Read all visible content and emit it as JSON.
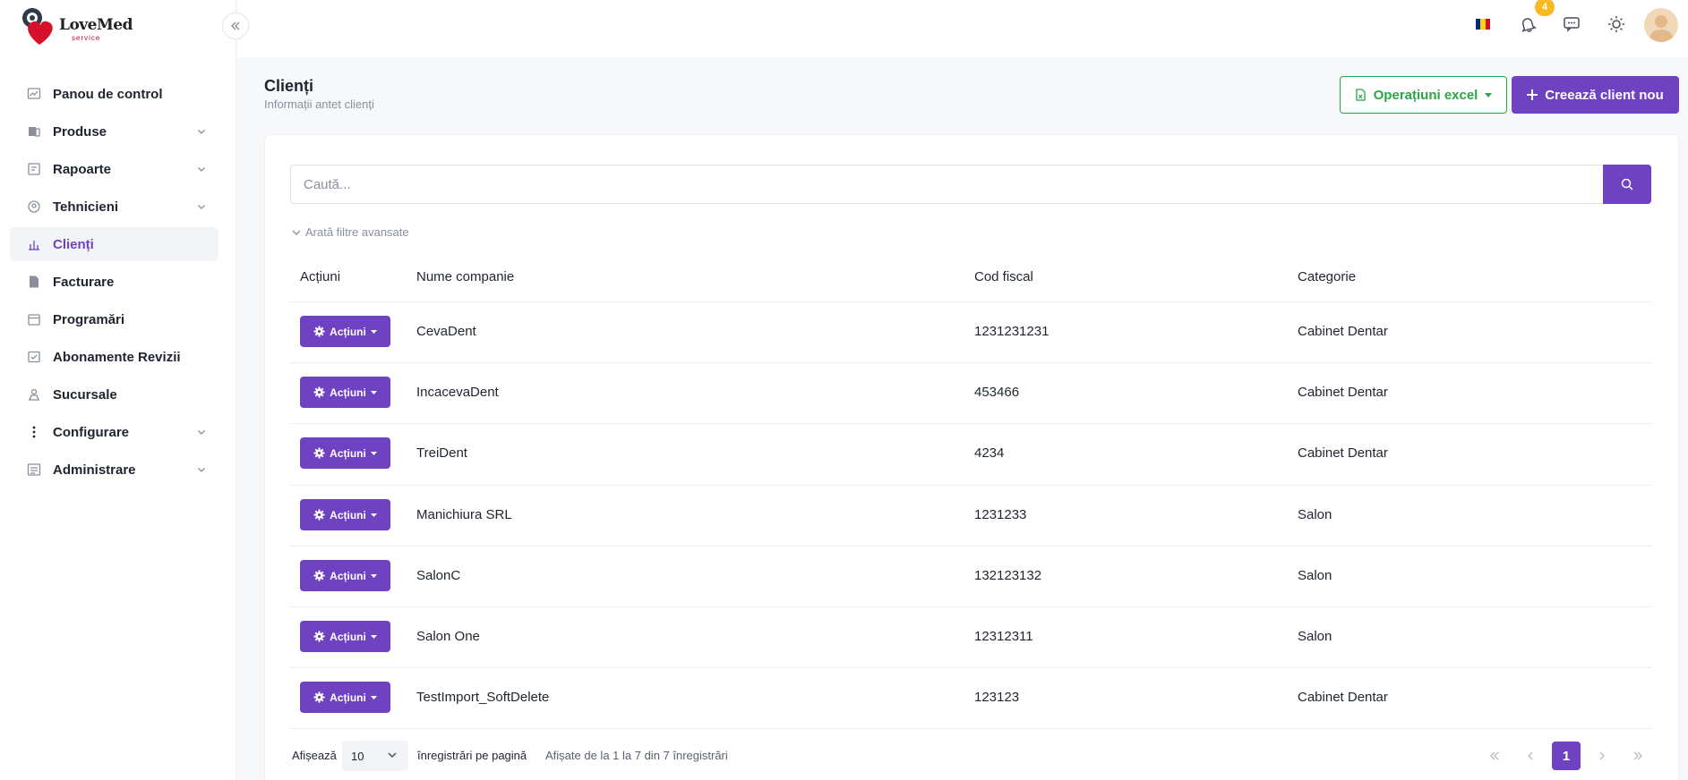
{
  "brand": {
    "name": "LoveMed",
    "tagline": "service"
  },
  "sidebar": {
    "items": [
      {
        "label": "Panou de control",
        "icon": "dashboard-icon",
        "has_submenu": false,
        "active": false
      },
      {
        "label": "Produse",
        "icon": "products-icon",
        "has_submenu": true,
        "active": false
      },
      {
        "label": "Rapoarte",
        "icon": "reports-icon",
        "has_submenu": true,
        "active": false
      },
      {
        "label": "Tehnicieni",
        "icon": "technicians-icon",
        "has_submenu": true,
        "active": false
      },
      {
        "label": "Clienți",
        "icon": "clients-icon",
        "has_submenu": false,
        "active": true
      },
      {
        "label": "Facturare",
        "icon": "invoice-icon",
        "has_submenu": false,
        "active": false
      },
      {
        "label": "Programări",
        "icon": "calendar-icon",
        "has_submenu": false,
        "active": false
      },
      {
        "label": "Abonamente Revizii",
        "icon": "subscription-icon",
        "has_submenu": false,
        "active": false
      },
      {
        "label": "Sucursale",
        "icon": "branches-icon",
        "has_submenu": false,
        "active": false
      },
      {
        "label": "Configurare",
        "icon": "more-vertical-icon",
        "has_submenu": true,
        "active": false
      },
      {
        "label": "Administrare",
        "icon": "admin-icon",
        "has_submenu": true,
        "active": false
      }
    ]
  },
  "topbar": {
    "notifications_count": "4",
    "language": "ro"
  },
  "header": {
    "title": "Clienți",
    "subtitle": "Informații antet clienți",
    "excel_label": "Operațiuni excel",
    "create_label": "Creează client nou"
  },
  "search": {
    "placeholder": "Caută..."
  },
  "filters": {
    "toggle_label": "Arată filtre avansate"
  },
  "table": {
    "columns": [
      "Acțiuni",
      "Nume companie",
      "Cod fiscal",
      "Categorie"
    ],
    "action_label": "Acțiuni",
    "rows": [
      {
        "company": "CevaDent",
        "fiscal_code": "1231231231",
        "category": "Cabinet Dentar"
      },
      {
        "company": "IncacevaDent",
        "fiscal_code": "453466",
        "category": "Cabinet Dentar"
      },
      {
        "company": "TreiDent",
        "fiscal_code": "4234",
        "category": "Cabinet Dentar"
      },
      {
        "company": "Manichiura SRL",
        "fiscal_code": "1231233",
        "category": "Salon"
      },
      {
        "company": "SalonC",
        "fiscal_code": "132123132",
        "category": "Salon"
      },
      {
        "company": "Salon One",
        "fiscal_code": "12312311",
        "category": "Salon"
      },
      {
        "company": "TestImport_SoftDelete",
        "fiscal_code": "123123",
        "category": "Cabinet Dentar"
      }
    ]
  },
  "pagination": {
    "show_label": "Afișează",
    "page_size": "10",
    "per_page_label": "înregistrări pe pagină",
    "info": "Afișate de la 1 la 7 din 7 înregistrări",
    "current_page": "1"
  },
  "colors": {
    "accent": "#6f42c1",
    "success": "#28a745",
    "badge": "#f7b924"
  }
}
